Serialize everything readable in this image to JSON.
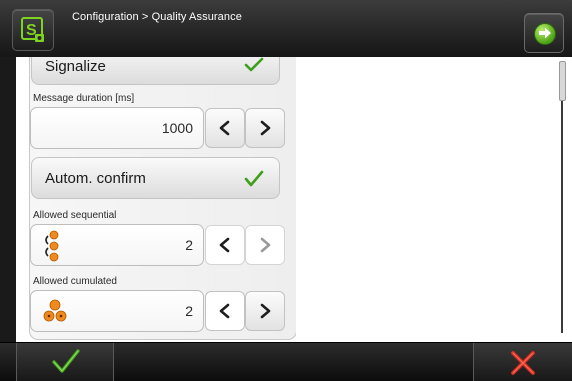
{
  "header": {
    "app_icon": "s-machine-icon",
    "breadcrumb": "Configuration > Quality Assurance",
    "next_icon": "arrow-right-circle-icon"
  },
  "settings": {
    "signalize": {
      "label": "Signalize",
      "checked": true
    },
    "message_duration": {
      "label": "Message duration [ms]",
      "value": "1000"
    },
    "autom_confirm": {
      "label": "Autom. confirm",
      "checked": true
    },
    "allowed_sequential": {
      "label": "Allowed sequential",
      "value": "2",
      "icon": "sequential-dots-icon"
    },
    "allowed_cumulated": {
      "label": "Allowed cumulated",
      "value": "2",
      "icon": "cumulated-dots-icon"
    }
  },
  "footer": {
    "confirm_icon": "checkmark-icon",
    "cancel_icon": "close-x-icon"
  },
  "colors": {
    "check_green": "#3f9e1c",
    "cancel_red": "#d42a1c",
    "dot_orange": "#f08a1e"
  }
}
